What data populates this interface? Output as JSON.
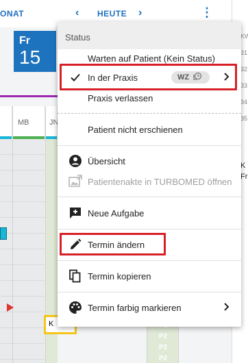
{
  "calendar": {
    "monat_label": "ONAT",
    "heute_label": "HEUTE",
    "day_name": "Fr",
    "day_number": "15",
    "col_mb": "MB",
    "col_jn": "JN",
    "kbox_label": "K",
    "p2_labels": [
      "P2",
      "P2",
      "P2",
      "P2",
      "P2"
    ],
    "right_numbers": [
      "KW",
      "31",
      "32",
      "33",
      "34",
      "35"
    ],
    "right_k": "K",
    "right_fr": "Fr"
  },
  "menu": {
    "status_header": "Status",
    "items": {
      "warten": "Warten auf Patient (Kein Status)",
      "praxis": "In der Praxis",
      "praxis_badge": "WZ",
      "verlassen": "Praxis verlassen",
      "nicht_erschienen": "Patient nicht erschienen",
      "uebersicht": "Übersicht",
      "akte": "Patientenakte in TURBOMED öffnen",
      "aufgabe": "Neue Aufgabe",
      "aendern": "Termin ändern",
      "kopieren": "Termin kopieren",
      "farbig": "Termin farbig markieren"
    }
  },
  "colors": {
    "accent": "#1e73be",
    "highlight": "#d71f27",
    "purple_line": "#9c27b0",
    "green_column": "#dfe9d5"
  }
}
